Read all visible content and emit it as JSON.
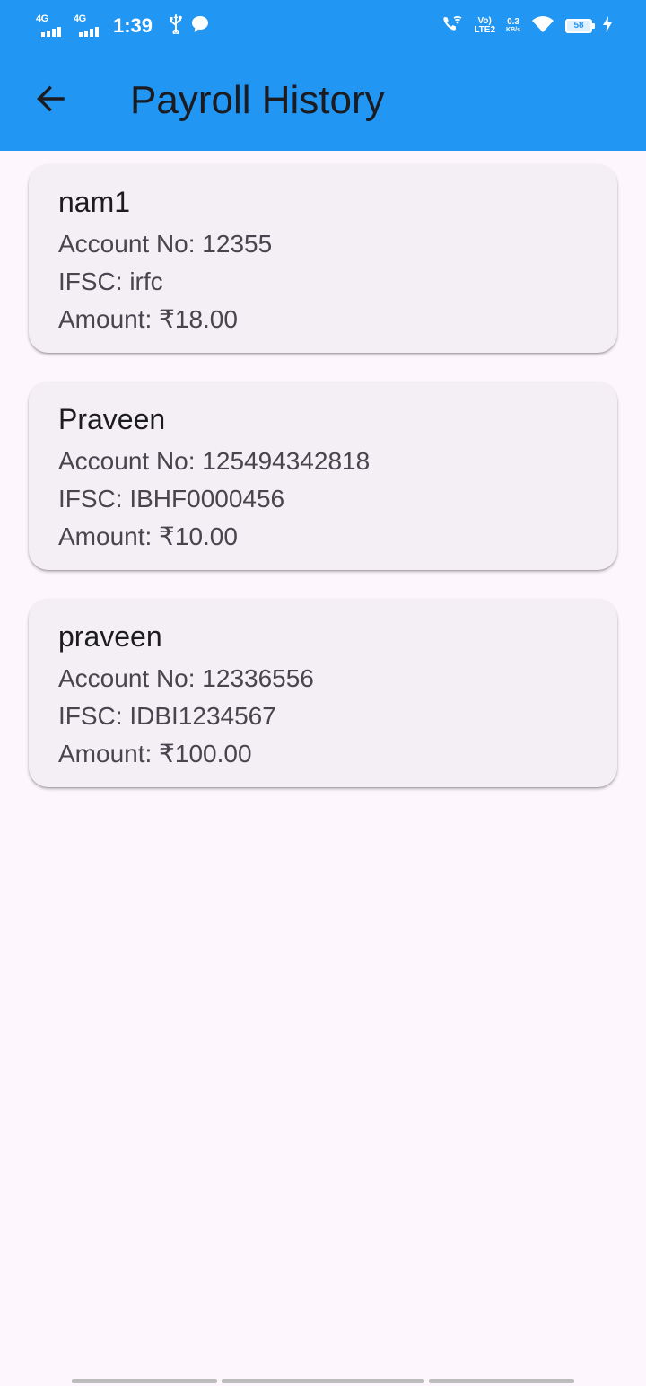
{
  "status_bar": {
    "network_1": "4G",
    "network_2": "4G",
    "time": "1:39",
    "volte_top": "Vo)",
    "volte_bottom": "LTE2",
    "speed_value": "0.3",
    "speed_unit": "KB/s",
    "battery_level": "58"
  },
  "app_bar": {
    "title": "Payroll History",
    "background_color": "#2196f3",
    "back_icon": "arrow-left-icon"
  },
  "payroll_records": [
    {
      "name": "nam1",
      "account_line": "Account No: 12355",
      "ifsc_line": "IFSC: irfc",
      "amount_line": "Amount: ₹18.00"
    },
    {
      "name": "Praveen",
      "account_line": "Account No: 125494342818",
      "ifsc_line": "IFSC: IBHF0000456",
      "amount_line": "Amount: ₹10.00"
    },
    {
      "name": "praveen",
      "account_line": "Account No: 12336556",
      "ifsc_line": "IFSC: IDBI1234567",
      "amount_line": "Amount: ₹100.00"
    }
  ],
  "colors": {
    "page_background": "#fdf7fd",
    "card_background": "#f4eff5",
    "primary_text": "#1c1b1f",
    "secondary_text": "#49454f"
  }
}
